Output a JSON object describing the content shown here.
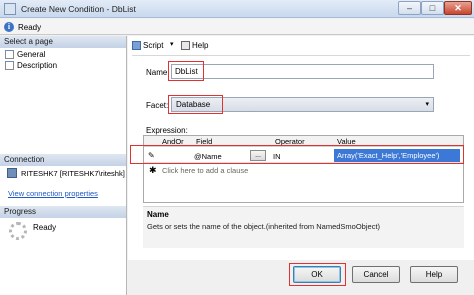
{
  "window": {
    "title": "Create New Condition - DbList",
    "controls": {
      "minimize": "–",
      "maximize": "□",
      "close": "✕"
    },
    "app_icon": "dialog-icon"
  },
  "status": {
    "text": "Ready",
    "icon": "info-icon"
  },
  "left": {
    "select_page_header": "Select a page",
    "pages": [
      {
        "label": "General",
        "icon": "page-icon"
      },
      {
        "label": "Description",
        "icon": "page-icon"
      }
    ],
    "connection_header": "Connection",
    "connection_text": "RITESHK7 [RITESHK7\\riteshk]",
    "connection_link": "View connection properties",
    "progress_header": "Progress",
    "progress_text": "Ready"
  },
  "toolbar": {
    "script_label": "Script",
    "help_label": "Help",
    "caret": "▾"
  },
  "form": {
    "name_label": "Name:",
    "name_value": "DbList",
    "facet_label": "Facet:",
    "facet_value": "Database",
    "facet_arrow": "▾",
    "expression_label": "Expression:"
  },
  "grid": {
    "headers": {
      "andor": "AndOr",
      "field": "Field",
      "operator": "Operator",
      "value": "Value"
    },
    "row": {
      "pencil": "✎",
      "field": "@Name",
      "ellipsis": "...",
      "operator": "IN",
      "value": "Array('Exact_Help','Employee')"
    },
    "add_mark": "✱",
    "add_clause": "Click here to add a clause"
  },
  "description": {
    "title": "Name",
    "text": "Gets or sets the name of the object.(inherited from NamedSmoObject)"
  },
  "buttons": {
    "ok": "OK",
    "cancel": "Cancel",
    "help": "Help"
  },
  "colors": {
    "highlight": "#e23131",
    "selection": "#3c78d6",
    "link": "#2159c4"
  }
}
